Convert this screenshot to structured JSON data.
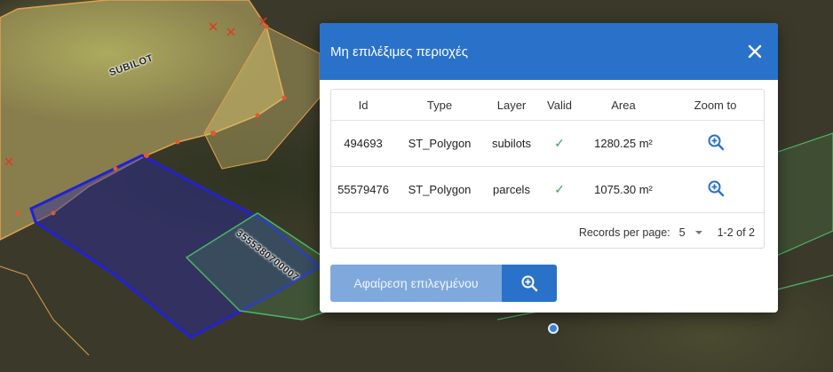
{
  "map": {
    "labels": [
      "SUBILOT",
      "3555380700007"
    ]
  },
  "dialog": {
    "title": "Μη επιλέξιμες περιοχές",
    "close_icon": "close-icon",
    "table": {
      "columns": [
        "Id",
        "Type",
        "Layer",
        "Valid",
        "Area",
        "Zoom to"
      ],
      "rows": [
        {
          "id": "494693",
          "type": "ST_Polygon",
          "layer": "subilots",
          "valid": "✓",
          "area": "1280.25 m²",
          "zoom_icon": "zoom-in-icon"
        },
        {
          "id": "55579476",
          "type": "ST_Polygon",
          "layer": "parcels",
          "valid": "✓",
          "area": "1075.30 m²",
          "zoom_icon": "zoom-in-icon"
        }
      ],
      "pagination": {
        "records_per_page_label": "Records per page:",
        "records_per_page_value": "5",
        "range": "1-2 of 2"
      }
    },
    "actions": {
      "remove_label": "Αφαίρεση επιλεγμένου",
      "zoom_icon": "zoom-in-icon"
    }
  },
  "colors": {
    "header": "#2a72c9",
    "remove_button": "#7fa9dc",
    "zoom_button": "#2a72c9",
    "check": "#3aa55d",
    "zoom_icon": "#2a72c9"
  }
}
